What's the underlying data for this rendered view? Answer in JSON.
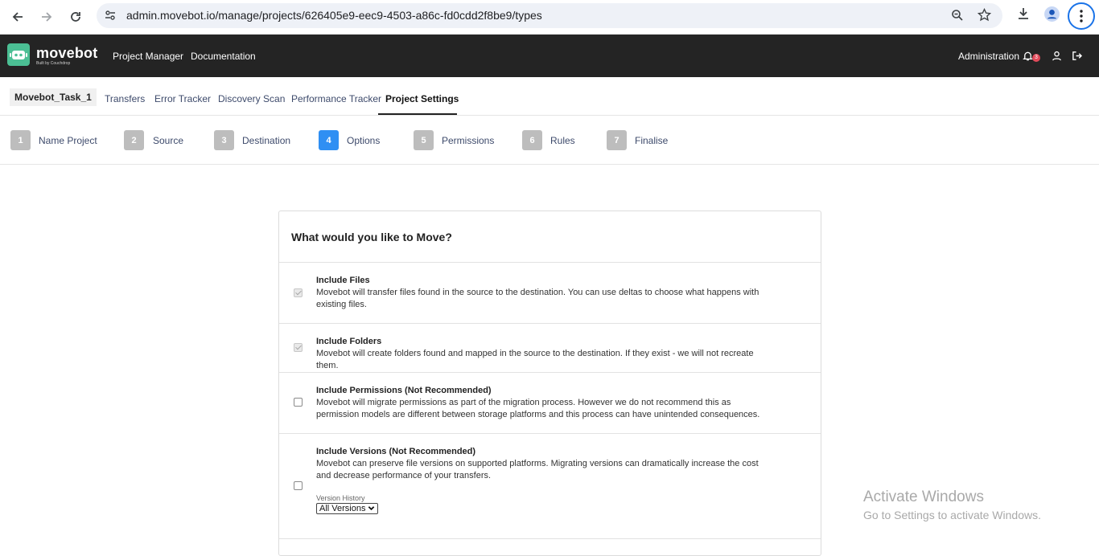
{
  "browser": {
    "url": "admin.movebot.io/manage/projects/626405e9-eec9-4503-a86c-fd0cdd2f8be9/types"
  },
  "header": {
    "logo": "movebot",
    "logo_sub": "Built by Couchdrop",
    "nav": [
      "Project Manager",
      "Documentation"
    ],
    "admin": "Administration",
    "notification_count": "3"
  },
  "project_tabs": {
    "project_name": "Movebot_Task_1",
    "tabs": [
      "Transfers",
      "Error Tracker",
      "Discovery Scan",
      "Performance Tracker",
      "Project Settings"
    ],
    "active": "Project Settings"
  },
  "steps": [
    {
      "num": "1",
      "label": "Name Project"
    },
    {
      "num": "2",
      "label": "Source"
    },
    {
      "num": "3",
      "label": "Destination"
    },
    {
      "num": "4",
      "label": "Options"
    },
    {
      "num": "5",
      "label": "Permissions"
    },
    {
      "num": "6",
      "label": "Rules"
    },
    {
      "num": "7",
      "label": "Finalise"
    }
  ],
  "active_step": "4",
  "card": {
    "title": "What would you like to Move?",
    "options": [
      {
        "title": "Include Files",
        "desc": "Movebot will transfer files found in the source to the destination. You can use deltas to choose what happens with existing files.",
        "checked": true
      },
      {
        "title": "Include Folders",
        "desc": "Movebot will create folders found and mapped in the source to the destination. If they exist - we will not recreate them.",
        "checked": true
      },
      {
        "title": "Include Permissions (Not Recommended)",
        "desc": "Movebot will migrate permissions as part of the migration process. However we do not recommend this as permission models are different between storage platforms and this process can have unintended consequences.",
        "checked": false
      },
      {
        "title": "Include Versions (Not Recommended)",
        "desc": "Movebot can preserve file versions on supported platforms. Migrating versions can dramatically increase the cost and decrease performance of your transfers.",
        "checked": false
      }
    ],
    "version_history_label": "Version History",
    "version_history_value": "All Versions"
  },
  "watermark": {
    "title": "Activate Windows",
    "subtitle": "Go to Settings to activate Windows."
  }
}
